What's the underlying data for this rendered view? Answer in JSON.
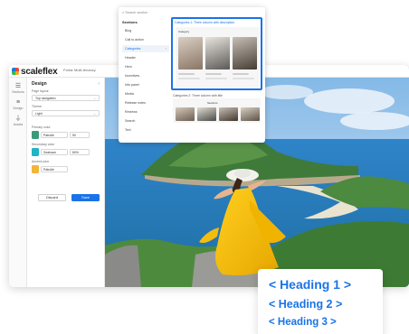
{
  "app": {
    "logo_text": "scaleflex",
    "titlebar_items": [
      "Portal",
      "Multi-tenancy"
    ]
  },
  "rail": {
    "items": [
      {
        "icon": "design-icon",
        "label": "Sections"
      },
      {
        "icon": "layers-icon",
        "label": "Design"
      },
      {
        "icon": "filter-icon",
        "label": "Assets"
      }
    ]
  },
  "design_panel": {
    "title": "Design",
    "collapse_icon": "chevron-left-icon",
    "page_layout_label": "Page layout",
    "page_layout_value": "Top navigation",
    "theme_label": "Theme",
    "theme_value": "Light",
    "primary_color_label": "Primary color",
    "primary_color_value": "Patrolle",
    "primary_color_alpha": "50",
    "primary_color_swatch": "#3a9a7a",
    "secondary_color_label": "Secondary color",
    "secondary_color_value": "Seafoam",
    "secondary_color_alpha": "80%",
    "secondary_color_swatch": "#1eb5c4",
    "accent_color_label": "Accent color",
    "accent_color_value": "Patrolle",
    "accent_color_swatch": "#f3b43a",
    "discard_label": "Discard",
    "save_label": "Save"
  },
  "popup": {
    "search_placeholder": "Search section",
    "section_title": "Sections",
    "items": [
      {
        "label": "Blog",
        "active": false
      },
      {
        "label": "Call to action",
        "active": false
      },
      {
        "label": "Categories",
        "active": true
      },
      {
        "label": "Header",
        "active": false
      },
      {
        "label": "Hero",
        "active": false
      },
      {
        "label": "Incentives",
        "active": false
      },
      {
        "label": "Info panel",
        "active": false
      },
      {
        "label": "Media",
        "active": false
      },
      {
        "label": "Release notes",
        "active": false
      },
      {
        "label": "Reviews",
        "active": false
      },
      {
        "label": "Search",
        "active": false
      },
      {
        "label": "Text",
        "active": false
      }
    ],
    "template1_label": "Categories 1: Three column with description",
    "template1_heading": "Category",
    "template2_label": "Categories 2: Three column with title",
    "template2_heading": "Sections"
  },
  "headings": {
    "h1": "< Heading 1 >",
    "h2": "< Heading 2 >",
    "h3": "< Heading 3 >"
  },
  "colors": {
    "brand_blue": "#1a73e8"
  }
}
